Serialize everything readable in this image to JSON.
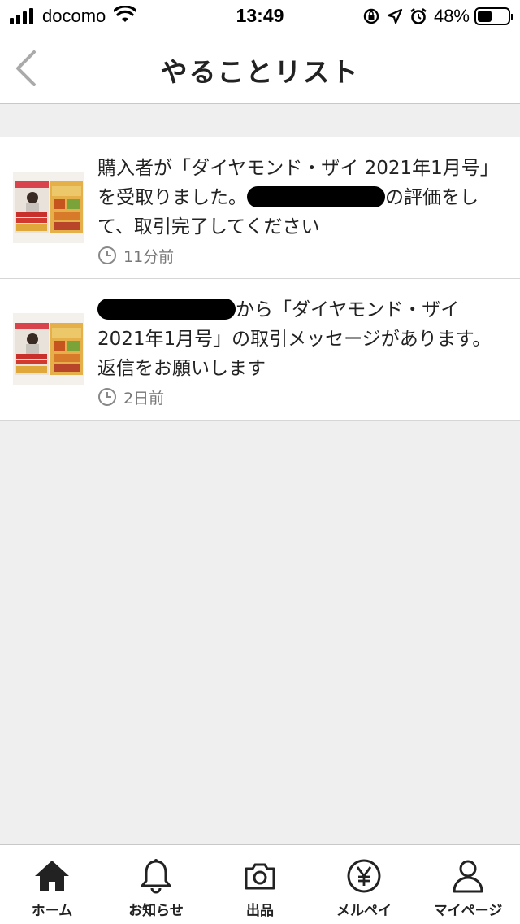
{
  "status_bar": {
    "carrier": "docomo",
    "time": "13:49",
    "battery": "48%",
    "battery_level": 0.48
  },
  "nav": {
    "title": "やることリスト",
    "back_icon": "chevron-left-icon"
  },
  "todo_items": [
    {
      "text_before": "購入者が「ダイヤモンド・ザイ 2021年1月号」を受取りました。",
      "text_after": "の評価をして、取引完了してください",
      "time": "11分前"
    },
    {
      "text_before": "",
      "text_after": "から「ダイヤモンド・ザイ 2021年1月号」の取引メッセージがあります。返信をお願いします",
      "time": "2日前"
    }
  ],
  "tab_bar": {
    "tabs": [
      {
        "label": "ホーム",
        "icon": "home-icon"
      },
      {
        "label": "お知らせ",
        "icon": "bell-icon"
      },
      {
        "label": "出品",
        "icon": "camera-icon"
      },
      {
        "label": "メルペイ",
        "icon": "yen-icon"
      },
      {
        "label": "マイページ",
        "icon": "person-icon"
      }
    ]
  },
  "colors": {
    "background": "#efefef",
    "surface": "#ffffff",
    "text": "#222222",
    "muted": "#777777"
  }
}
